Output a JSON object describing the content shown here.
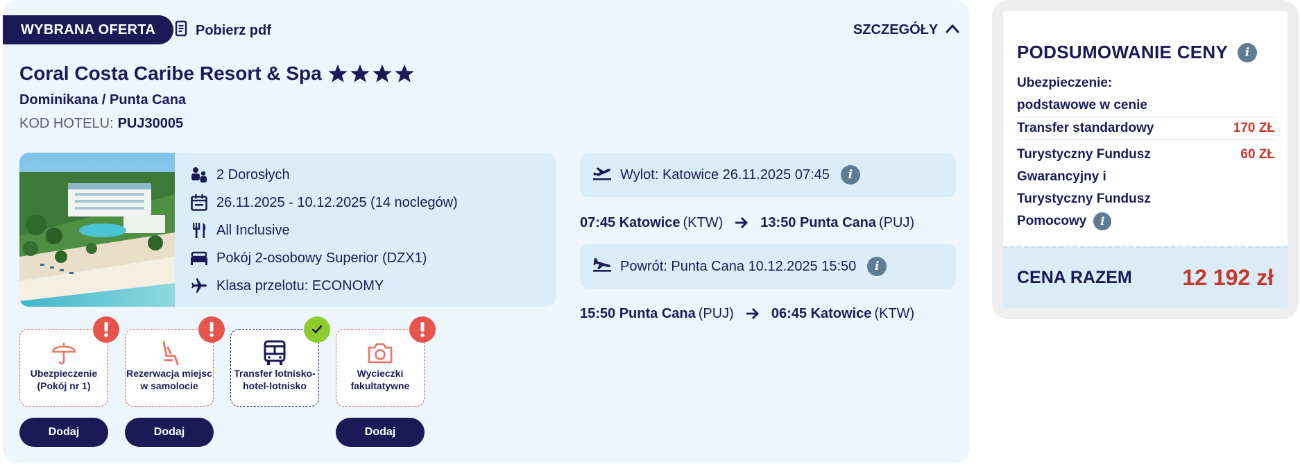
{
  "offer": {
    "badge": "WYBRANA OFERTA",
    "pdf_label": "Pobierz pdf",
    "details_label": "SZCZEGÓŁY",
    "hotel_name": "Coral Costa Caribe Resort & Spa",
    "stars": 4,
    "location": "Dominikana / Punta Cana",
    "code_label": "KOD HOTELU:",
    "code_value": "PUJ30005",
    "info": {
      "travellers": "2 Dorosłych",
      "dates": "26.11.2025 - 10.12.2025 (14 noclegów)",
      "board": "All Inclusive",
      "room": "Pokój 2-osobowy Superior (DZX1)",
      "flight_class": "Klasa przelotu: ECONOMY"
    },
    "outbound": {
      "label": "Wylot: Katowice",
      "datetime": "26.11.2025 07:45",
      "dep_time_city": "07:45 Katowice",
      "dep_code": "(KTW)",
      "arr_time_city": "13:50 Punta Cana",
      "arr_code": "(PUJ)"
    },
    "return": {
      "label": "Powrót: Punta Cana",
      "datetime": "10.12.2025 15:50",
      "dep_time_city": "15:50 Punta Cana",
      "dep_code": "(PUJ)",
      "arr_time_city": "06:45 Katowice",
      "arr_code": "(KTW)"
    },
    "extras": [
      {
        "line1": "Ubezpieczenie",
        "line2": "(Pokój nr 1)",
        "status": "warning",
        "button": "Dodaj"
      },
      {
        "line1": "Rezerwacja miejsc",
        "line2": "w samolocie",
        "status": "warning",
        "button": "Dodaj"
      },
      {
        "line1": "Transfer lotnisko-",
        "line2": "hotel-lotnisko",
        "status": "ok",
        "button": ""
      },
      {
        "line1": "Wycieczki",
        "line2": "fakultatywne",
        "status": "warning",
        "button": "Dodaj"
      }
    ]
  },
  "summary": {
    "title": "PODSUMOWANIE CENY",
    "insurance_label": "Ubezpieczenie:",
    "insurance_value": "podstawowe w cenie",
    "transfer_label": "Transfer standardowy",
    "transfer_amount": "170 ZŁ",
    "fund_line1": "Turystyczny Fundusz",
    "fund_line2": "Gwarancyjny i",
    "fund_line3": "Turystyczny Fundusz",
    "fund_line4": "Pomocowy",
    "fund_amount": "60 ZŁ",
    "total_label": "CENA RAZEM",
    "total_value": "12 192 zł"
  },
  "colors": {
    "navy": "#1b1a57",
    "panel": "#edf6fc",
    "box": "#dbedf9",
    "price_red": "#c9362c",
    "warning": "#e6544c",
    "ok": "#8ccc2c"
  }
}
